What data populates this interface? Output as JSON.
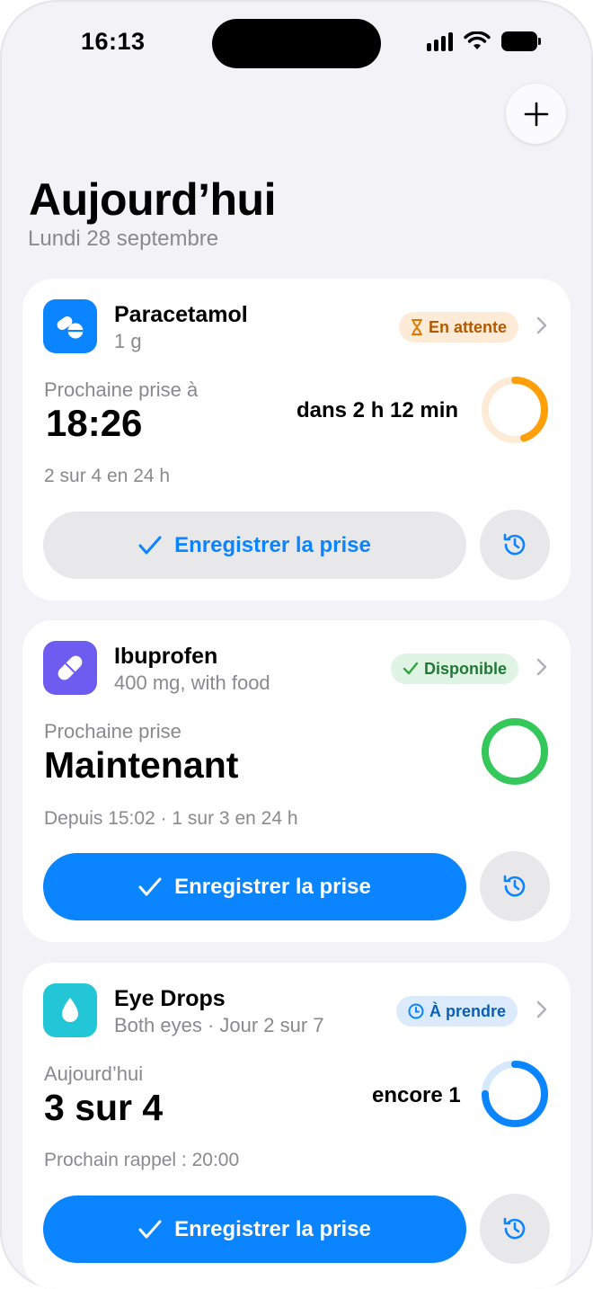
{
  "status_bar": {
    "time": "16:13"
  },
  "header": {
    "title": "Aujourd’hui",
    "subtitle": "Lundi 28 septembre",
    "add_icon": "plus-icon"
  },
  "colors": {
    "accent": "#0A84FF",
    "pending": "#FF9F0A",
    "available": "#34C759",
    "background": "#F2F2F7"
  },
  "medications": [
    {
      "name": "Paracetamol",
      "dose": "1 g",
      "icon": "pills-icon",
      "status": "En attente",
      "status_icon": "hourglass-icon",
      "next_label": "Prochaine prise à",
      "next_value": "18:26",
      "countdown": "dans 2 h 12 min",
      "progress_fraction": 0.45,
      "footer": "2 sur 4 en 24 h",
      "action": "Enregistrer la prise"
    },
    {
      "name": "Ibuprofen",
      "dose": "400 mg, with food",
      "icon": "capsule-icon",
      "status": "Disponible",
      "status_icon": "check-icon",
      "next_label": "Prochaine prise",
      "next_value": "Maintenant",
      "progress_fraction": 1.0,
      "footer": "Depuis 15:02 · 1 sur 3 en 24 h",
      "action": "Enregistrer la prise"
    },
    {
      "name": "Eye Drops",
      "dose": "Both eyes · Jour 2 sur 7",
      "icon": "drop-icon",
      "status": "À prendre",
      "status_icon": "clock-icon",
      "next_label": "Aujourd’hui",
      "next_value": "3 sur 4",
      "remaining": "encore 1",
      "progress_fraction": 0.75,
      "footer": "Prochain rappel : 20:00",
      "action": "Enregistrer la prise"
    }
  ]
}
